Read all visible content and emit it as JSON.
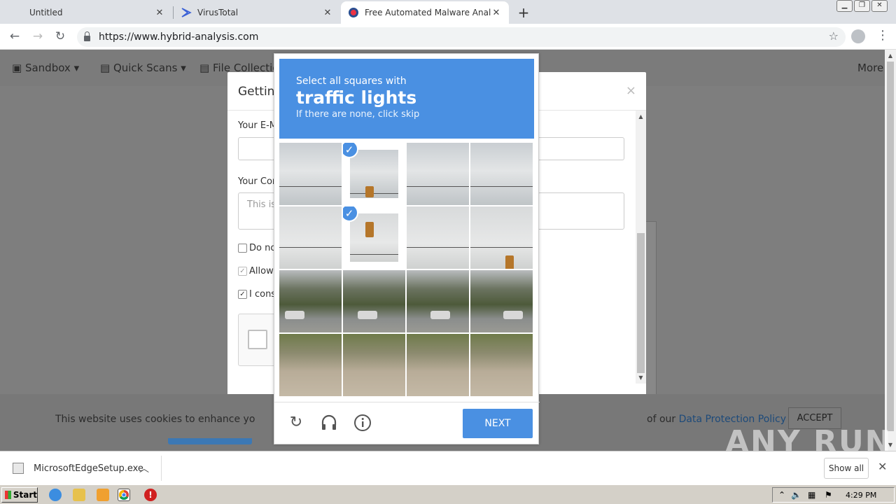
{
  "browser": {
    "tabs": [
      {
        "title": "Untitled",
        "active": false
      },
      {
        "title": "VirusTotal",
        "active": false
      },
      {
        "title": "Free Automated Malware Analysis Se",
        "active": true
      }
    ],
    "url": "https://www.hybrid-analysis.com",
    "new_tab": "+",
    "window_controls": [
      "minimize",
      "restore",
      "close"
    ]
  },
  "site_nav": {
    "items": [
      "Sandbox",
      "Quick Scans",
      "File Collection",
      "More"
    ]
  },
  "modal": {
    "title": "Getting",
    "email_label": "Your E-M",
    "comment_label": "Your Cor",
    "comment_placeholder": "This is",
    "checkboxes": [
      {
        "label": "Do no",
        "checked": false
      },
      {
        "label": "Allow",
        "checked": true
      },
      {
        "label": "I cons",
        "checked": true
      }
    ],
    "close": "×"
  },
  "captcha": {
    "instruction": "Select all squares with",
    "target": "traffic lights",
    "hint": "If there are none, click skip",
    "selected_tiles": [
      1,
      5
    ],
    "next_label": "NEXT",
    "icons": [
      "reload-icon",
      "audio-icon",
      "info-icon"
    ]
  },
  "cookie_banner": {
    "text": "This website uses cookies to enhance yo",
    "text_end": "of our",
    "policy_link": "Data Protection Policy",
    "accept_label": "ACCEPT"
  },
  "watermark": "ANY RUN",
  "download_bar": {
    "file": "MicrosoftEdgeSetup.exe",
    "show_all": "Show all"
  },
  "taskbar": {
    "start": "Start",
    "clock": "4:29 PM"
  },
  "colors": {
    "captcha_blue": "#4a90e2",
    "site_blue": "#3c78b4",
    "overlay_gray": "#7e7e7e"
  }
}
